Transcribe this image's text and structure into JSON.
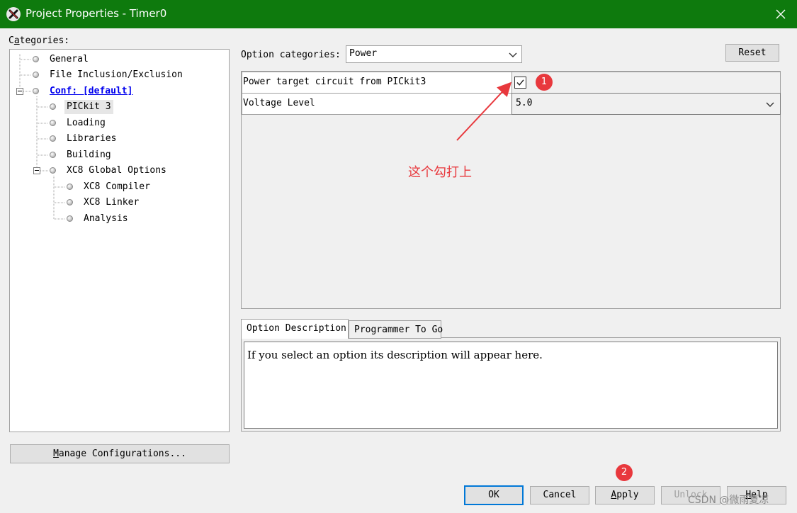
{
  "window": {
    "title": "Project Properties - Timer0",
    "accent_color": "#0e7a0d",
    "app_icon": "mplab-x-icon",
    "close_icon": "close-icon"
  },
  "categories": {
    "label_prefix": "C",
    "label_mnemonic": "a",
    "label_rest": "tegories:",
    "items": [
      {
        "label": "General"
      },
      {
        "label": "File Inclusion/Exclusion"
      },
      {
        "label": "Conf: [default]"
      },
      {
        "label": "PICkit 3"
      },
      {
        "label": "Loading"
      },
      {
        "label": "Libraries"
      },
      {
        "label": "Building"
      },
      {
        "label": "XC8 Global Options"
      },
      {
        "label": "XC8 Compiler"
      },
      {
        "label": "XC8 Linker"
      },
      {
        "label": "Analysis"
      }
    ]
  },
  "options": {
    "category_label": "Option categories:",
    "category_value": "Power",
    "reset_label": "Reset"
  },
  "properties": [
    {
      "name": "Power target circuit from PICkit3",
      "checked": true
    },
    {
      "name": "Voltage Level",
      "value": "5.0"
    }
  ],
  "tabs": [
    {
      "label": "Option Description"
    },
    {
      "label": "Programmer To Go"
    }
  ],
  "description_text": "If you select an option its description will appear here.",
  "buttons": {
    "manage_mnemonic": "M",
    "manage_rest": "anage Configurations...",
    "ok": "OK",
    "cancel": "Cancel",
    "apply_mnemonic": "A",
    "apply_rest": "pply",
    "unlock": "Unlock",
    "help_mnemonic": "H",
    "help_rest": "elp"
  },
  "annotations": {
    "badge1": "1",
    "badge2": "2",
    "note": "这个勾打上",
    "color": "#e8383d"
  },
  "watermark": "CSDN @微雨夏凉"
}
